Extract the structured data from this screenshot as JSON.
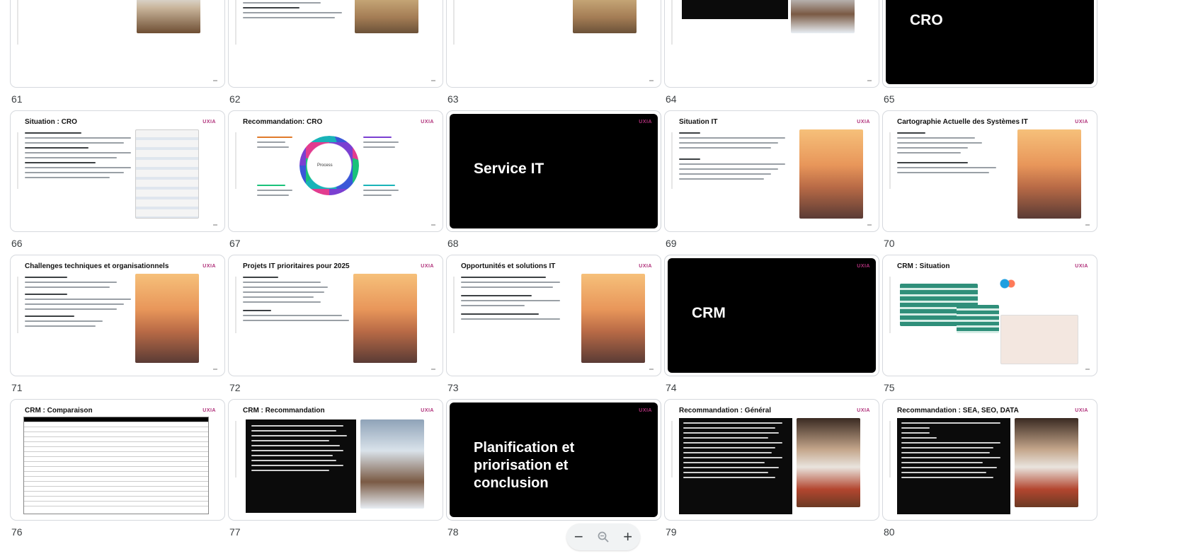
{
  "slides": [
    {
      "num": "61",
      "kind": "text-photo",
      "photo": "snow"
    },
    {
      "num": "62",
      "kind": "text-photo",
      "photo": "terrace"
    },
    {
      "num": "63",
      "kind": "text-photo",
      "photo": "terrace"
    },
    {
      "num": "64",
      "kind": "dark-photo",
      "photo": "chalet"
    },
    {
      "num": "65",
      "kind": "section",
      "title": "CRO"
    },
    {
      "num": "66",
      "kind": "text-photo",
      "title": "Situation : CRO",
      "photo": "doc"
    },
    {
      "num": "67",
      "kind": "diagram",
      "title": "Recommandation: CRO",
      "center": "Process"
    },
    {
      "num": "68",
      "kind": "section",
      "title": "Service IT"
    },
    {
      "num": "69",
      "kind": "text-photo",
      "title": "Situation IT",
      "photo": "sunset"
    },
    {
      "num": "70",
      "kind": "text-photo",
      "title": "Cartographie Actuelle des Systèmes IT",
      "photo": "sunset"
    },
    {
      "num": "71",
      "kind": "text-photo",
      "title": "Challenges techniques et organisationnels",
      "photo": "sunset"
    },
    {
      "num": "72",
      "kind": "text-photo",
      "title": "Projets IT prioritaires pour 2025",
      "photo": "sunset"
    },
    {
      "num": "73",
      "kind": "text-photo",
      "title": "Opportunités et solutions IT",
      "photo": "sunset"
    },
    {
      "num": "74",
      "kind": "section",
      "title": "CRM"
    },
    {
      "num": "75",
      "kind": "screens",
      "title": "CRM : Situation"
    },
    {
      "num": "76",
      "kind": "table",
      "title": "CRM : Comparaison"
    },
    {
      "num": "77",
      "kind": "dark-photo",
      "title": "CRM : Recommandation",
      "photo": "chalet"
    },
    {
      "num": "78",
      "kind": "section",
      "title": "Planification et priorisation et conclusion"
    },
    {
      "num": "79",
      "kind": "dark-photo",
      "title": "Recommandation : Général",
      "photo": "chef"
    },
    {
      "num": "80",
      "kind": "dark-photo",
      "title": "Recommandation : SEA, SEO, DATA",
      "photo": "chef"
    }
  ],
  "brand": "UXIA",
  "zoom": {
    "out_icon": "minus-icon",
    "reset_icon": "zoom-out-magnifier-icon",
    "in_icon": "plus-icon",
    "minus": "−",
    "plus": "+"
  }
}
